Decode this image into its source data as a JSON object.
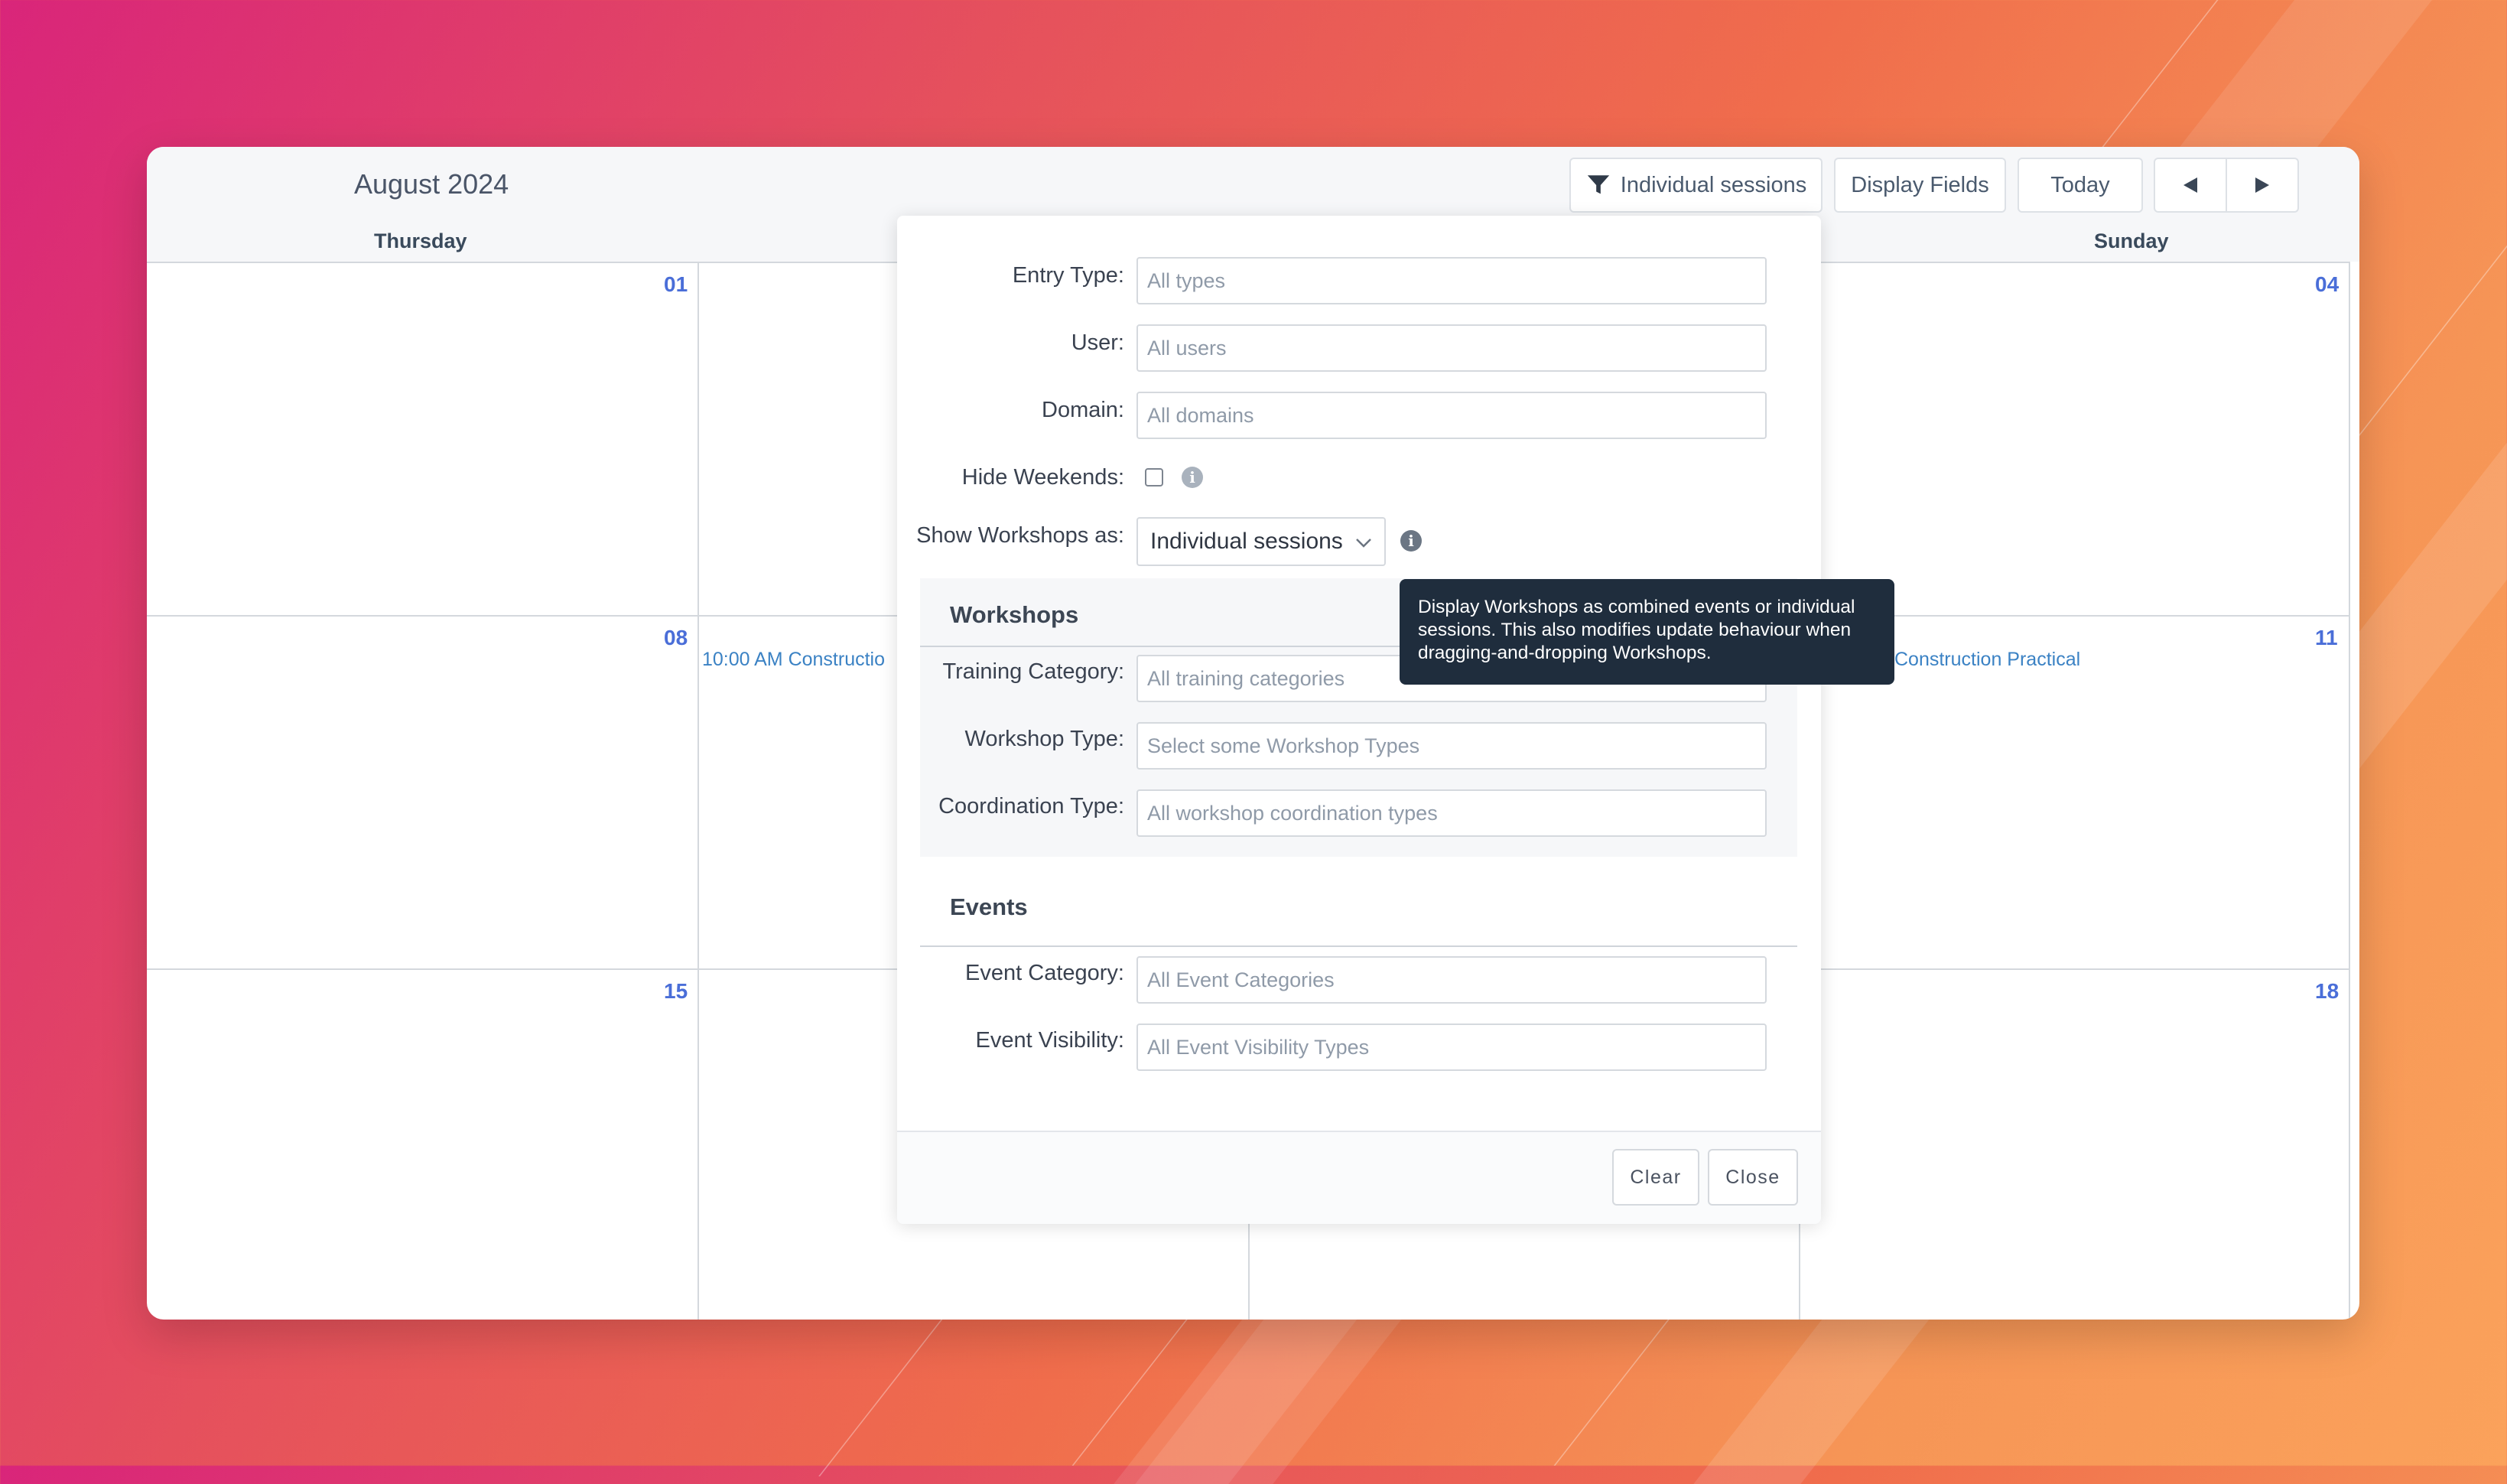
{
  "calendar": {
    "month_title": "August 2024",
    "toolbar": {
      "filter_label": "Individual sessions",
      "display_fields_label": "Display Fields",
      "today_label": "Today",
      "prev_icon": "triangle-left-icon",
      "next_icon": "triangle-right-icon"
    },
    "day_names": {
      "thursday": "Thursday",
      "sunday": "Sunday"
    },
    "dates": {
      "d01": "01",
      "d04": "04",
      "d08": "08",
      "d11": "11",
      "d15": "15",
      "d18": "18"
    },
    "events": {
      "fri_08": "10:00 AM Constructio",
      "sun_11": "Construction Practical"
    }
  },
  "filter_panel": {
    "entry_type": {
      "label": "Entry Type:",
      "placeholder": "All types"
    },
    "user": {
      "label": "User:",
      "placeholder": "All users"
    },
    "domain": {
      "label": "Domain:",
      "placeholder": "All domains"
    },
    "hide_weekends": {
      "label": "Hide Weekends:",
      "checked": false
    },
    "show_workshops": {
      "label": "Show Workshops as:",
      "value": "Individual sessions"
    },
    "workshops_section": {
      "title": "Workshops",
      "training_category": {
        "label": "Training Category:",
        "placeholder": "All training categories"
      },
      "workshop_type": {
        "label": "Workshop Type:",
        "placeholder": "Select some Workshop Types"
      },
      "coordination_type": {
        "label": "Coordination Type:",
        "placeholder": "All workshop coordination types"
      }
    },
    "events_section": {
      "title": "Events",
      "event_category": {
        "label": "Event Category:",
        "placeholder": "All Event Categories"
      },
      "event_visibility": {
        "label": "Event Visibility:",
        "placeholder": "All Event Visibility Types"
      }
    },
    "footer": {
      "clear_label": "Clear",
      "close_label": "Close"
    }
  },
  "tooltip": {
    "line1": "Display Workshops as combined events or individual",
    "line2": "sessions. This also modifies update behaviour when",
    "line3": "dragging-and-dropping Workshops."
  },
  "colors": {
    "accent_date": "#4a6ed8",
    "event_link": "#3b82c4",
    "tooltip_bg": "#1f2d3d",
    "info_icon_light": "#a9b2bd",
    "info_icon_dark": "#6b7684"
  }
}
